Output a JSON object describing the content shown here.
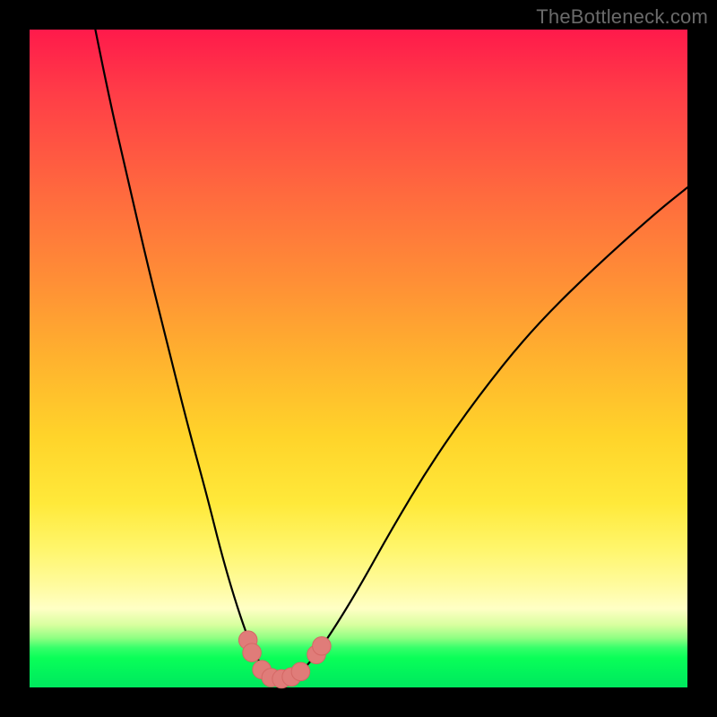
{
  "watermark": "TheBottleneck.com",
  "colors": {
    "frame": "#000000",
    "curve_stroke": "#000000",
    "marker_fill": "#e07c79",
    "marker_stroke": "#d46865"
  },
  "chart_data": {
    "type": "line",
    "title": "",
    "xlabel": "",
    "ylabel": "",
    "xlim": [
      0,
      100
    ],
    "ylim": [
      0,
      100
    ],
    "grid": false,
    "legend": false,
    "series": [
      {
        "name": "bottleneck-curve",
        "x": [
          10,
          12,
          15,
          18,
          21,
          24,
          27,
          29,
          31,
          33,
          34.5,
          36,
          37.5,
          39,
          41,
          43,
          46,
          50,
          55,
          61,
          68,
          76,
          85,
          95,
          100
        ],
        "values": [
          100,
          90,
          77,
          64,
          52,
          40,
          29,
          21,
          14,
          8,
          4.5,
          2.3,
          1.4,
          1.4,
          2.2,
          4.2,
          8.5,
          15,
          24,
          34,
          44,
          54,
          63,
          72,
          76
        ]
      }
    ],
    "markers": [
      {
        "x": 33.2,
        "y": 7.2,
        "r": 1.4
      },
      {
        "x": 33.8,
        "y": 5.3,
        "r": 1.4
      },
      {
        "x": 35.3,
        "y": 2.7,
        "r": 1.4
      },
      {
        "x": 36.7,
        "y": 1.5,
        "r": 1.4
      },
      {
        "x": 38.3,
        "y": 1.3,
        "r": 1.4
      },
      {
        "x": 39.8,
        "y": 1.6,
        "r": 1.4
      },
      {
        "x": 41.2,
        "y": 2.4,
        "r": 1.4
      },
      {
        "x": 43.6,
        "y": 5.0,
        "r": 1.4
      },
      {
        "x": 44.4,
        "y": 6.3,
        "r": 1.4
      }
    ]
  }
}
